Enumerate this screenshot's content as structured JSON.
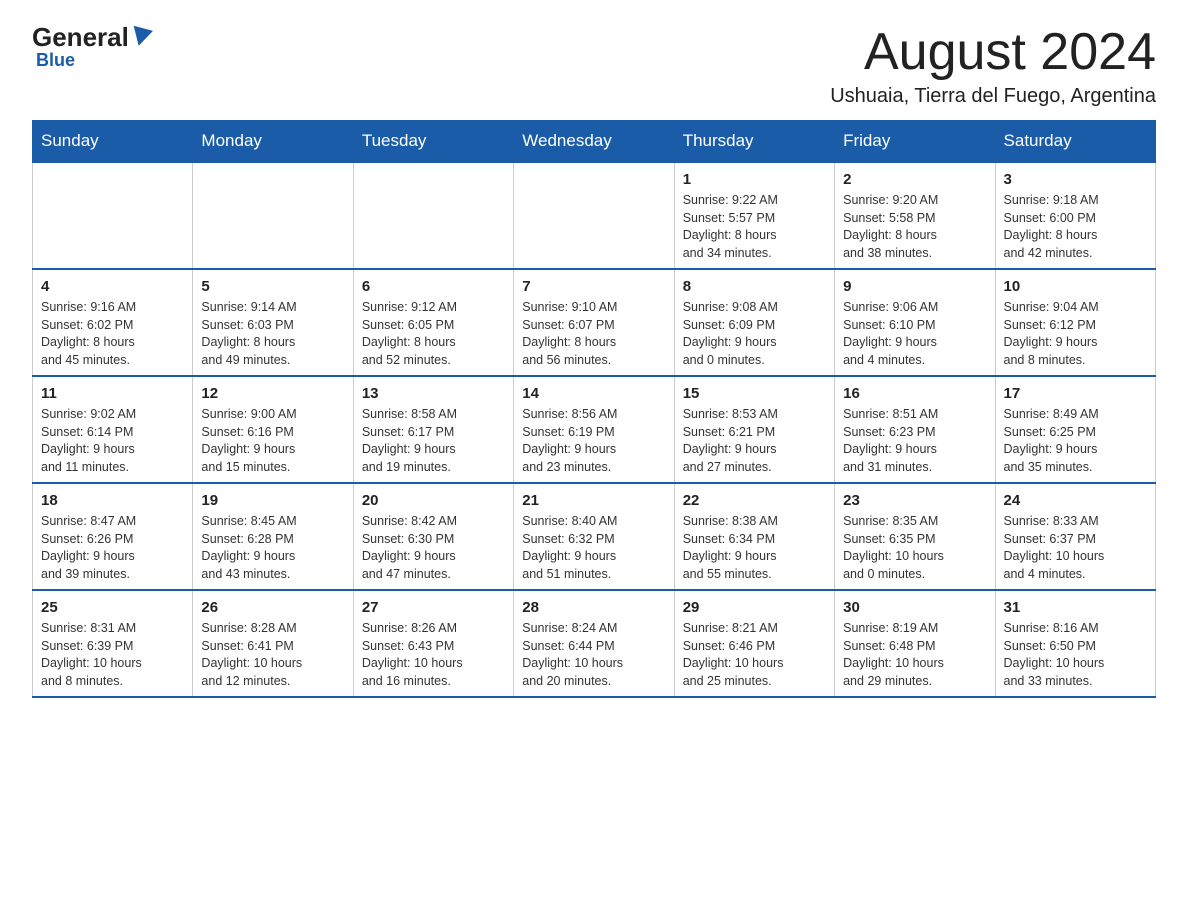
{
  "logo": {
    "general": "General",
    "blue": "Blue"
  },
  "header": {
    "title": "August 2024",
    "subtitle": "Ushuaia, Tierra del Fuego, Argentina"
  },
  "weekdays": [
    "Sunday",
    "Monday",
    "Tuesday",
    "Wednesday",
    "Thursday",
    "Friday",
    "Saturday"
  ],
  "weeks": [
    [
      {
        "day": "",
        "info": ""
      },
      {
        "day": "",
        "info": ""
      },
      {
        "day": "",
        "info": ""
      },
      {
        "day": "",
        "info": ""
      },
      {
        "day": "1",
        "info": "Sunrise: 9:22 AM\nSunset: 5:57 PM\nDaylight: 8 hours\nand 34 minutes."
      },
      {
        "day": "2",
        "info": "Sunrise: 9:20 AM\nSunset: 5:58 PM\nDaylight: 8 hours\nand 38 minutes."
      },
      {
        "day": "3",
        "info": "Sunrise: 9:18 AM\nSunset: 6:00 PM\nDaylight: 8 hours\nand 42 minutes."
      }
    ],
    [
      {
        "day": "4",
        "info": "Sunrise: 9:16 AM\nSunset: 6:02 PM\nDaylight: 8 hours\nand 45 minutes."
      },
      {
        "day": "5",
        "info": "Sunrise: 9:14 AM\nSunset: 6:03 PM\nDaylight: 8 hours\nand 49 minutes."
      },
      {
        "day": "6",
        "info": "Sunrise: 9:12 AM\nSunset: 6:05 PM\nDaylight: 8 hours\nand 52 minutes."
      },
      {
        "day": "7",
        "info": "Sunrise: 9:10 AM\nSunset: 6:07 PM\nDaylight: 8 hours\nand 56 minutes."
      },
      {
        "day": "8",
        "info": "Sunrise: 9:08 AM\nSunset: 6:09 PM\nDaylight: 9 hours\nand 0 minutes."
      },
      {
        "day": "9",
        "info": "Sunrise: 9:06 AM\nSunset: 6:10 PM\nDaylight: 9 hours\nand 4 minutes."
      },
      {
        "day": "10",
        "info": "Sunrise: 9:04 AM\nSunset: 6:12 PM\nDaylight: 9 hours\nand 8 minutes."
      }
    ],
    [
      {
        "day": "11",
        "info": "Sunrise: 9:02 AM\nSunset: 6:14 PM\nDaylight: 9 hours\nand 11 minutes."
      },
      {
        "day": "12",
        "info": "Sunrise: 9:00 AM\nSunset: 6:16 PM\nDaylight: 9 hours\nand 15 minutes."
      },
      {
        "day": "13",
        "info": "Sunrise: 8:58 AM\nSunset: 6:17 PM\nDaylight: 9 hours\nand 19 minutes."
      },
      {
        "day": "14",
        "info": "Sunrise: 8:56 AM\nSunset: 6:19 PM\nDaylight: 9 hours\nand 23 minutes."
      },
      {
        "day": "15",
        "info": "Sunrise: 8:53 AM\nSunset: 6:21 PM\nDaylight: 9 hours\nand 27 minutes."
      },
      {
        "day": "16",
        "info": "Sunrise: 8:51 AM\nSunset: 6:23 PM\nDaylight: 9 hours\nand 31 minutes."
      },
      {
        "day": "17",
        "info": "Sunrise: 8:49 AM\nSunset: 6:25 PM\nDaylight: 9 hours\nand 35 minutes."
      }
    ],
    [
      {
        "day": "18",
        "info": "Sunrise: 8:47 AM\nSunset: 6:26 PM\nDaylight: 9 hours\nand 39 minutes."
      },
      {
        "day": "19",
        "info": "Sunrise: 8:45 AM\nSunset: 6:28 PM\nDaylight: 9 hours\nand 43 minutes."
      },
      {
        "day": "20",
        "info": "Sunrise: 8:42 AM\nSunset: 6:30 PM\nDaylight: 9 hours\nand 47 minutes."
      },
      {
        "day": "21",
        "info": "Sunrise: 8:40 AM\nSunset: 6:32 PM\nDaylight: 9 hours\nand 51 minutes."
      },
      {
        "day": "22",
        "info": "Sunrise: 8:38 AM\nSunset: 6:34 PM\nDaylight: 9 hours\nand 55 minutes."
      },
      {
        "day": "23",
        "info": "Sunrise: 8:35 AM\nSunset: 6:35 PM\nDaylight: 10 hours\nand 0 minutes."
      },
      {
        "day": "24",
        "info": "Sunrise: 8:33 AM\nSunset: 6:37 PM\nDaylight: 10 hours\nand 4 minutes."
      }
    ],
    [
      {
        "day": "25",
        "info": "Sunrise: 8:31 AM\nSunset: 6:39 PM\nDaylight: 10 hours\nand 8 minutes."
      },
      {
        "day": "26",
        "info": "Sunrise: 8:28 AM\nSunset: 6:41 PM\nDaylight: 10 hours\nand 12 minutes."
      },
      {
        "day": "27",
        "info": "Sunrise: 8:26 AM\nSunset: 6:43 PM\nDaylight: 10 hours\nand 16 minutes."
      },
      {
        "day": "28",
        "info": "Sunrise: 8:24 AM\nSunset: 6:44 PM\nDaylight: 10 hours\nand 20 minutes."
      },
      {
        "day": "29",
        "info": "Sunrise: 8:21 AM\nSunset: 6:46 PM\nDaylight: 10 hours\nand 25 minutes."
      },
      {
        "day": "30",
        "info": "Sunrise: 8:19 AM\nSunset: 6:48 PM\nDaylight: 10 hours\nand 29 minutes."
      },
      {
        "day": "31",
        "info": "Sunrise: 8:16 AM\nSunset: 6:50 PM\nDaylight: 10 hours\nand 33 minutes."
      }
    ]
  ]
}
